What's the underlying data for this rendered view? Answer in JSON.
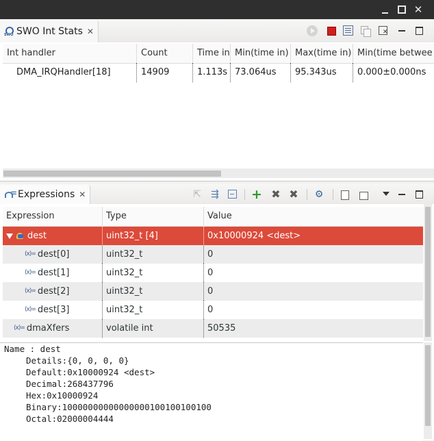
{
  "window": {
    "controls": {
      "close": "✕"
    }
  },
  "swo": {
    "tab_title": "SWO Int Stats",
    "tab_close": "✕",
    "columns": [
      "Int handler",
      "Count",
      "Time in",
      "Min(time in)",
      "Max(time in)",
      "Min(time between)"
    ],
    "rows": [
      [
        "DMA_IRQHandler[18]",
        "14909",
        "1.113s",
        "73.064us",
        "95.343us",
        "0.000±0.000ns"
      ]
    ],
    "columns_visible": [
      "Int handler",
      "Count",
      "Time in",
      "Min(time in)",
      "Max(time in)",
      "Min(time betwee"
    ]
  },
  "expressions": {
    "tab_title": "Expressions",
    "tab_close": "✕",
    "columns": [
      "Expression",
      "Type",
      "Value"
    ],
    "rows": [
      {
        "name": "dest",
        "type": "uint32_t [4]",
        "value": "0x10000924 <dest>",
        "expanded": true,
        "selected": true
      },
      {
        "name": "dest[0]",
        "type": "uint32_t",
        "value": "0"
      },
      {
        "name": "dest[1]",
        "type": "uint32_t",
        "value": "0"
      },
      {
        "name": "dest[2]",
        "type": "uint32_t",
        "value": "0"
      },
      {
        "name": "dest[3]",
        "type": "uint32_t",
        "value": "0"
      },
      {
        "name": "dmaXfers",
        "type": "volatile int",
        "value": "50535"
      }
    ],
    "var_icon": "(x)="
  },
  "details": {
    "lines": [
      "Name : dest",
      "Details:{0, 0, 0, 0}",
      "Default:0x10000924 <dest>",
      "Decimal:268437796",
      "Hex:0x10000924",
      "Binary:10000000000000000100100100100",
      "Octal:02000004444"
    ]
  }
}
